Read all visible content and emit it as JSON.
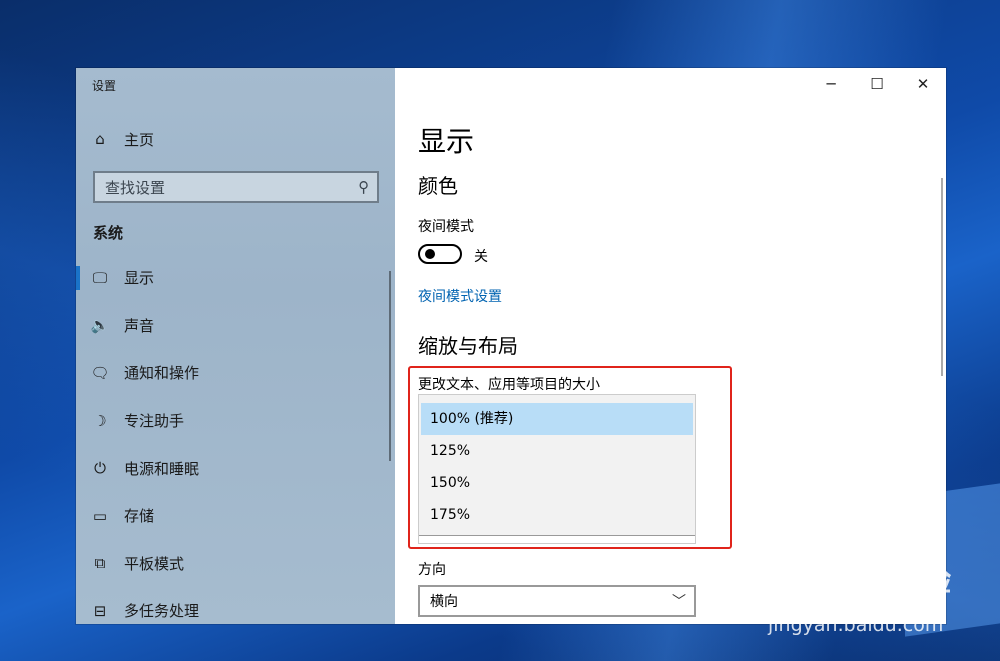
{
  "window": {
    "title": "设置",
    "minimize": "─",
    "maximize": "☐",
    "close": "✕"
  },
  "sidebar": {
    "home": {
      "icon": "home-icon",
      "glyph": "⌂",
      "label": "主页"
    },
    "search": {
      "placeholder": "查找设置",
      "icon": "search-icon"
    },
    "section": "系统",
    "items": [
      {
        "label": "显示",
        "icon": "monitor-icon",
        "glyph": "🖵"
      },
      {
        "label": "声音",
        "icon": "speaker-icon",
        "glyph": "🔈"
      },
      {
        "label": "通知和操作",
        "icon": "notification-icon",
        "glyph": "🗨"
      },
      {
        "label": "专注助手",
        "icon": "moon-icon",
        "glyph": "☽"
      },
      {
        "label": "电源和睡眠",
        "icon": "power-icon",
        "glyph": "⏻"
      },
      {
        "label": "存储",
        "icon": "storage-icon",
        "glyph": "▭"
      },
      {
        "label": "平板模式",
        "icon": "tablet-icon",
        "glyph": "⧉"
      },
      {
        "label": "多任务处理",
        "icon": "multitask-icon",
        "glyph": "⊟"
      }
    ]
  },
  "content": {
    "title": "显示",
    "color_section": "颜色",
    "night_mode_label": "夜间模式",
    "night_mode_state": "关",
    "night_mode_link": "夜间模式设置",
    "scale_section": "缩放与布局",
    "scale_label": "更改文本、应用等项目的大小",
    "scale_options": [
      "100% (推荐)",
      "125%",
      "150%",
      "175%"
    ],
    "orientation_label": "方向",
    "orientation_value": "横向"
  },
  "watermark": {
    "brand": "Bai du 经验",
    "url": "jingyan.baidu.com"
  },
  "colors": {
    "accent": "#1a73c8",
    "link": "#0063b1",
    "highlight": "#e0241b",
    "selected": "#b8ddf7"
  }
}
